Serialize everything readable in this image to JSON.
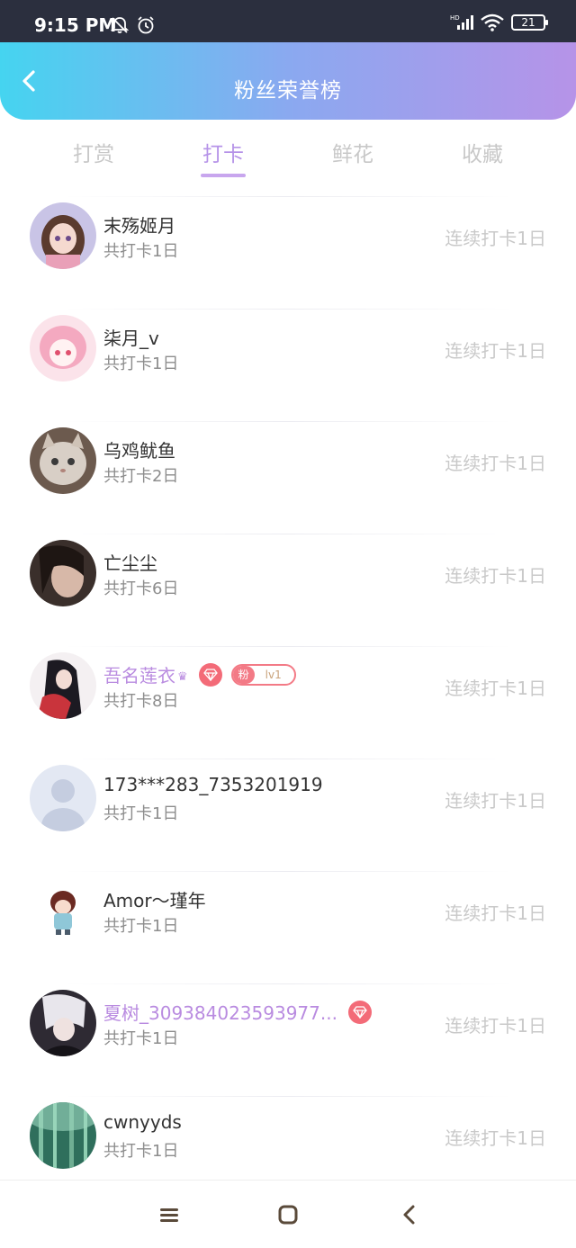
{
  "status_bar": {
    "time": "9:15 PM",
    "icons": [
      "mute-bell-icon",
      "alarm-icon",
      "hd-signal-icon",
      "wifi-icon",
      "battery-icon"
    ],
    "battery": "21"
  },
  "header": {
    "title": "粉丝荣誉榜",
    "back_icon": "chevron-left-icon"
  },
  "tabs": [
    {
      "label": "打赏",
      "active": false
    },
    {
      "label": "打卡",
      "active": true
    },
    {
      "label": "鲜花",
      "active": false
    },
    {
      "label": "收藏",
      "active": false
    }
  ],
  "colors": {
    "header_gradient": [
      "#45d4f0",
      "#b693e8"
    ],
    "accent": "#b693e8",
    "vip_name": "#b98be0",
    "badge": "#f36b78"
  },
  "rows": [
    {
      "name": "末殇姬月",
      "sub": "共打卡1日",
      "streak": "连续打卡1日"
    },
    {
      "name": "柒月_v",
      "sub": "共打卡1日",
      "streak": "连续打卡1日"
    },
    {
      "name": "乌鸡鱿鱼",
      "sub": "共打卡2日",
      "streak": "连续打卡1日"
    },
    {
      "name": "亡尘尘",
      "sub": "共打卡6日",
      "streak": "连续打卡1日"
    },
    {
      "name": "吾名莲衣",
      "sub": "共打卡8日",
      "streak": "连续打卡1日",
      "vip": true,
      "fan_badge": {
        "label": "粉",
        "level": "lv1"
      }
    },
    {
      "name": "173***283_7353201919",
      "sub": "共打卡1日",
      "streak": "连续打卡1日"
    },
    {
      "name": "Amor～瑾年",
      "sub": "共打卡1日",
      "streak": "连续打卡1日"
    },
    {
      "name": "夏树_309384023593977...",
      "sub": "共打卡1日",
      "streak": "连续打卡1日",
      "vip": true
    },
    {
      "name": "cwnyyds",
      "sub": "共打卡1日",
      "streak": "连续打卡1日"
    }
  ],
  "nav_bar": {
    "icons": [
      "menu-icon",
      "home-square-icon",
      "back-triangle-icon"
    ]
  }
}
